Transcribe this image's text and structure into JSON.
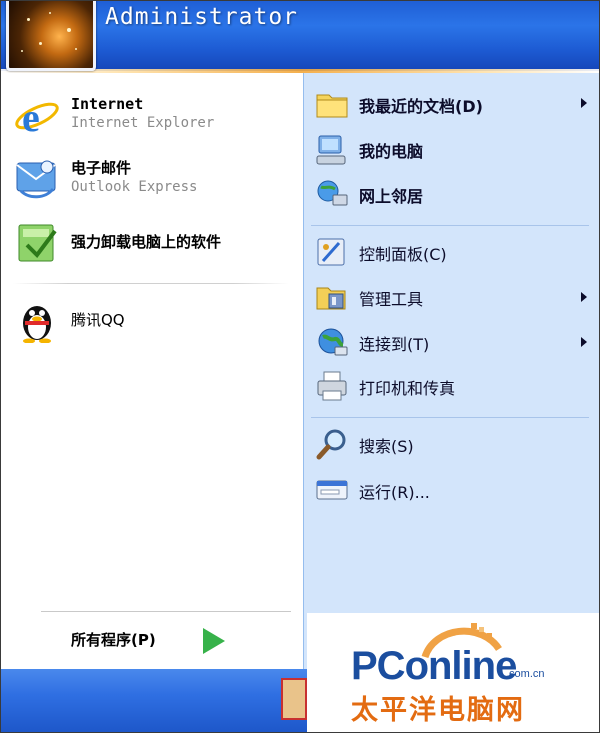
{
  "header": {
    "username": "Administrator"
  },
  "left_pinned": [
    {
      "title": "Internet",
      "subtitle": "Internet Explorer"
    },
    {
      "title": "电子邮件",
      "subtitle": "Outlook Express"
    }
  ],
  "left_recent": [
    {
      "label": "强力卸载电脑上的软件"
    },
    {
      "label": "腾讯QQ"
    }
  ],
  "all_programs": {
    "label": "所有程序(P)"
  },
  "right_items": [
    {
      "label": "我最近的文档(D)",
      "submenu": true
    },
    {
      "label": "我的电脑",
      "submenu": false
    },
    {
      "label": "网上邻居",
      "submenu": false
    },
    {
      "label": "控制面板(C)",
      "submenu": false
    },
    {
      "label": "管理工具",
      "submenu": true
    },
    {
      "label": "连接到(T)",
      "submenu": true
    },
    {
      "label": "打印机和传真",
      "submenu": false
    },
    {
      "label": "搜索(S)",
      "submenu": false
    },
    {
      "label": "运行(R)...",
      "submenu": false
    }
  ],
  "watermark": {
    "brand": "PConline",
    "domain": ".com.cn",
    "chinese": "太平洋电脑网"
  }
}
